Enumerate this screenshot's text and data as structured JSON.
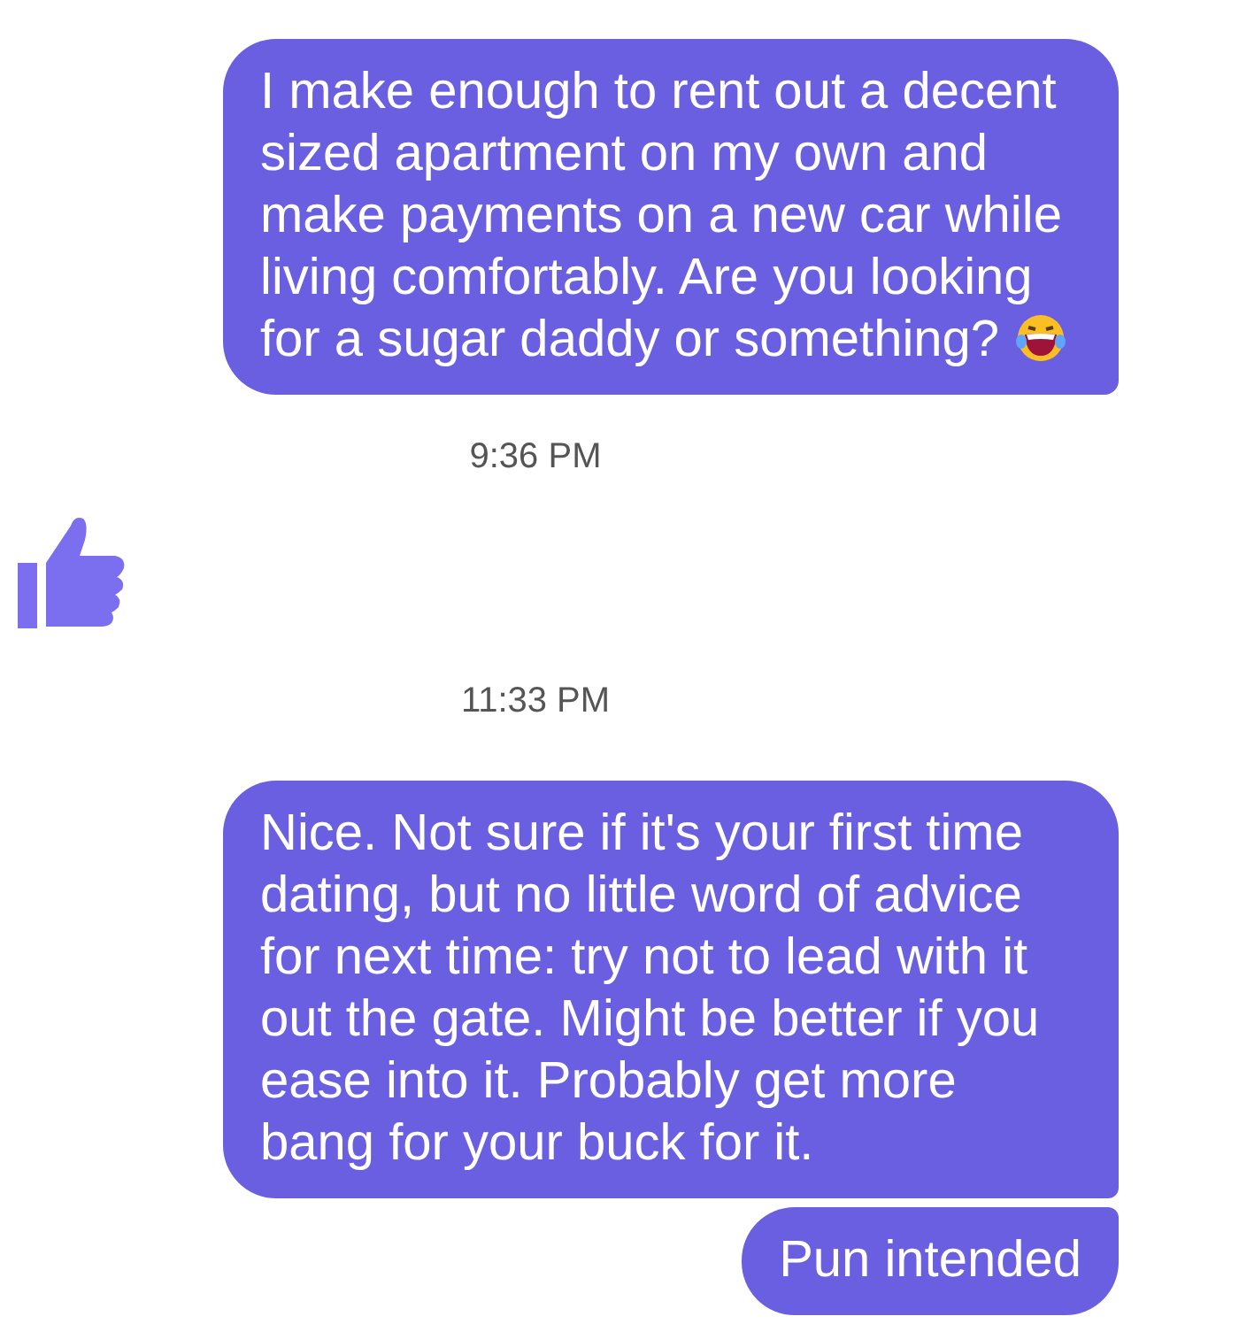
{
  "messages": [
    {
      "kind": "bubble_single",
      "text": "I make enough to rent out a decent sized apartment on my own and make payments on a new car while living comfortably. Are you looking for a sugar daddy or something?",
      "emoji": true
    },
    {
      "kind": "time",
      "text": "9:36 PM"
    },
    {
      "kind": "like"
    },
    {
      "kind": "time",
      "text": "11:33 PM"
    },
    {
      "kind": "bubble_first",
      "text": "Nice. Not sure if it's your first time dating, but no little word of advice for next time: try not to lead with it out the gate. Might be better if you ease into it. Probably get more bang for your buck for it.",
      "emoji": false
    },
    {
      "kind": "bubble_last",
      "text": "Pun intended",
      "emoji": false
    }
  ]
}
